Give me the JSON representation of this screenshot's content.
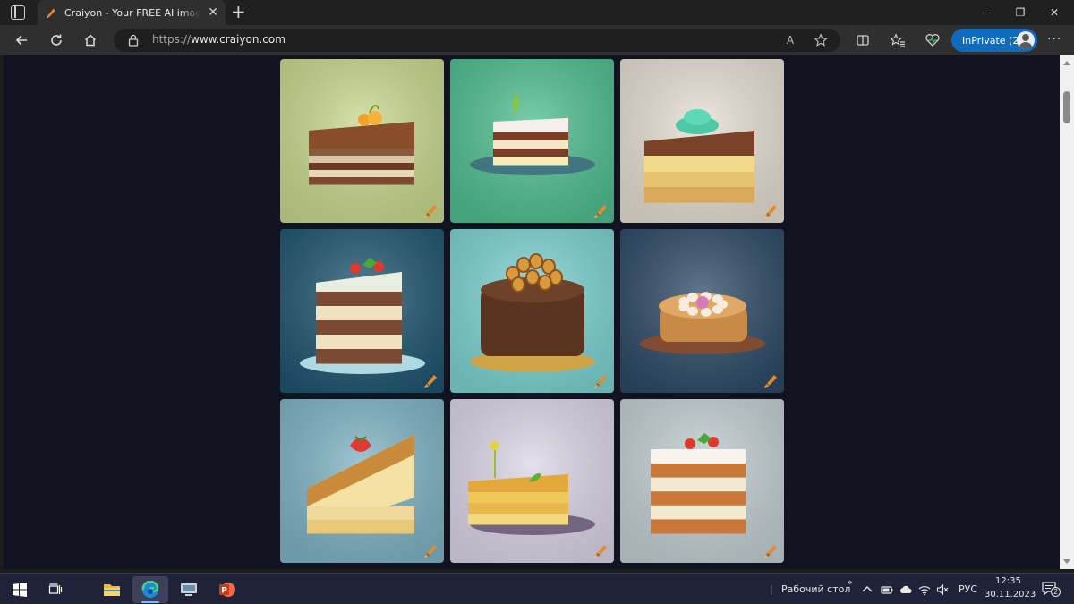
{
  "browser": {
    "tab": {
      "title": "Craiyon - Your FREE AI image generator",
      "close_glyph": "✕"
    },
    "new_tab_glyph": "+",
    "window_controls": {
      "minimize": "—",
      "maximize": "❐",
      "close": "✕"
    },
    "address": {
      "protocol": "https://",
      "host": "www.craiyon.com"
    },
    "read_aloud_glyph": "A",
    "inprivate_label": "InPrivate (2)",
    "more_glyph": "···"
  },
  "gallery": {
    "images": [
      {
        "bg": "#c9d98e",
        "style": "wedge-dark",
        "topping": "fruit"
      },
      {
        "bg": "#4fbf8f",
        "style": "wedge-plate",
        "topping": "leaf"
      },
      {
        "bg": "#e7dfd2",
        "style": "wedge-sponge",
        "topping": "cream"
      },
      {
        "bg": "#1f5670",
        "style": "tall-slice",
        "topping": "berries"
      },
      {
        "bg": "#7dd3d3",
        "style": "round-choc",
        "topping": "nuts"
      },
      {
        "bg": "#2d4a66",
        "style": "tart",
        "topping": "cream-ring"
      },
      {
        "bg": "#7fb3c4",
        "style": "wedge-side",
        "topping": "strawberry"
      },
      {
        "bg": "#dcd6e6",
        "style": "wedge-yellow",
        "topping": "sprout"
      },
      {
        "bg": "#c4cfd3",
        "style": "layer-block",
        "topping": "berries"
      }
    ],
    "accent_color": "#e38b2f"
  },
  "taskbar": {
    "apps": [
      "start-button",
      "task-view",
      "file-explorer",
      "edge",
      "remote-desktop",
      "powerpoint"
    ],
    "desktop_label": "Рабочий стол",
    "chevron": "»",
    "language": "РУС",
    "time": "12:35",
    "date": "30.11.2023",
    "notification_count": "2"
  }
}
